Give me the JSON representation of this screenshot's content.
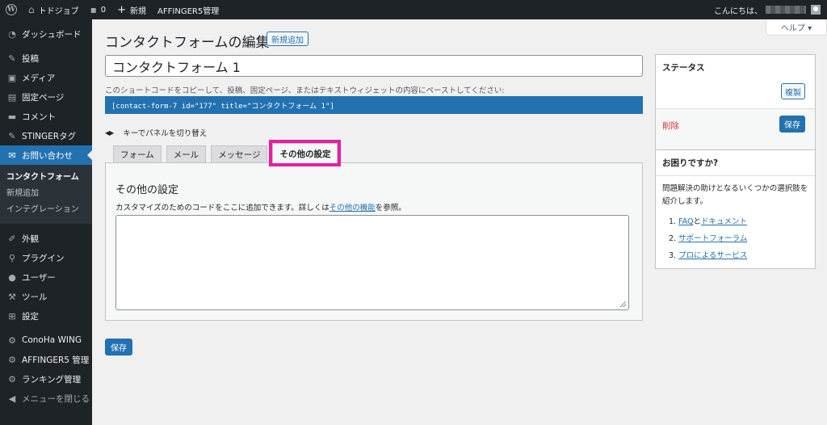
{
  "adminbar": {
    "site_name": "トドジョブ",
    "comments_count": "0",
    "new_label": "新規",
    "affinger_label": "AFFINGER5管理",
    "greeting": "こんにちは、"
  },
  "sidebar": {
    "items_top": [
      {
        "label": "ダッシュボード",
        "icon": "gauge-icon"
      }
    ],
    "items_mid": [
      {
        "label": "投稿",
        "icon": "pin-icon"
      },
      {
        "label": "メディア",
        "icon": "media-icon"
      },
      {
        "label": "固定ページ",
        "icon": "page-icon"
      },
      {
        "label": "コメント",
        "icon": "comment-icon"
      },
      {
        "label": "STINGERタグ",
        "icon": "pin-icon"
      }
    ],
    "active_item": {
      "label": "お問い合わせ",
      "icon": "mail-icon"
    },
    "submenu": [
      "コンタクトフォーム",
      "新規追加",
      "インテグレーション"
    ],
    "items_bottom": [
      {
        "label": "外観",
        "icon": "brush-icon"
      },
      {
        "label": "プラグイン",
        "icon": "plugin-icon"
      },
      {
        "label": "ユーザー",
        "icon": "user-icon"
      },
      {
        "label": "ツール",
        "icon": "wrench-icon"
      },
      {
        "label": "設定",
        "icon": "settings-icon"
      }
    ],
    "items_extra": [
      {
        "label": "ConoHa WING",
        "icon": "gear-icon"
      },
      {
        "label": "AFFINGER5 管理",
        "icon": "gear-icon"
      },
      {
        "label": "ランキング管理",
        "icon": "gear-icon"
      }
    ],
    "collapse_label": "メニューを閉じる"
  },
  "header": {
    "help_label": "ヘルプ ▾",
    "title": "コンタクトフォームの編集",
    "add_new_label": "新規追加"
  },
  "form": {
    "title_value": "コンタクトフォーム 1",
    "shortcode_hint": "このショートコードをコピーして、投稿、固定ページ、またはテキストウィジェットの内容にペーストしてください:",
    "shortcode": "[contact-form-7 id=\"177\" title=\"コンタクトフォーム 1\"]",
    "keys_hint": "キーでパネルを切り替え",
    "tabs": [
      "フォーム",
      "メール",
      "メッセージ",
      "その他の設定"
    ],
    "panel_title": "その他の設定",
    "panel_desc_before": "カスタマイズのためのコードをここに追加できます。詳しくは",
    "panel_desc_link": "その他の機能",
    "panel_desc_after": "を参照。",
    "save_label": "保存"
  },
  "status_box": {
    "title": "ステータス",
    "duplicate_label": "複製",
    "delete_label": "削除",
    "save_label": "保存"
  },
  "help_box": {
    "title": "お困りですか?",
    "description": "問題解決の助けとなるいくつかの選択肢を紹介します。",
    "links": [
      {
        "num": "1.",
        "a": "FAQ",
        "mid": "と",
        "b": "ドキュメント"
      },
      {
        "num": "2.",
        "a": "サポートフォーラム"
      },
      {
        "num": "3.",
        "a": "プロによるサービス"
      }
    ]
  },
  "colors": {
    "accent": "#2271b1",
    "highlight_outline": "#e61fa0",
    "sidebar_bg": "#1d2327",
    "delete": "#d63638"
  }
}
